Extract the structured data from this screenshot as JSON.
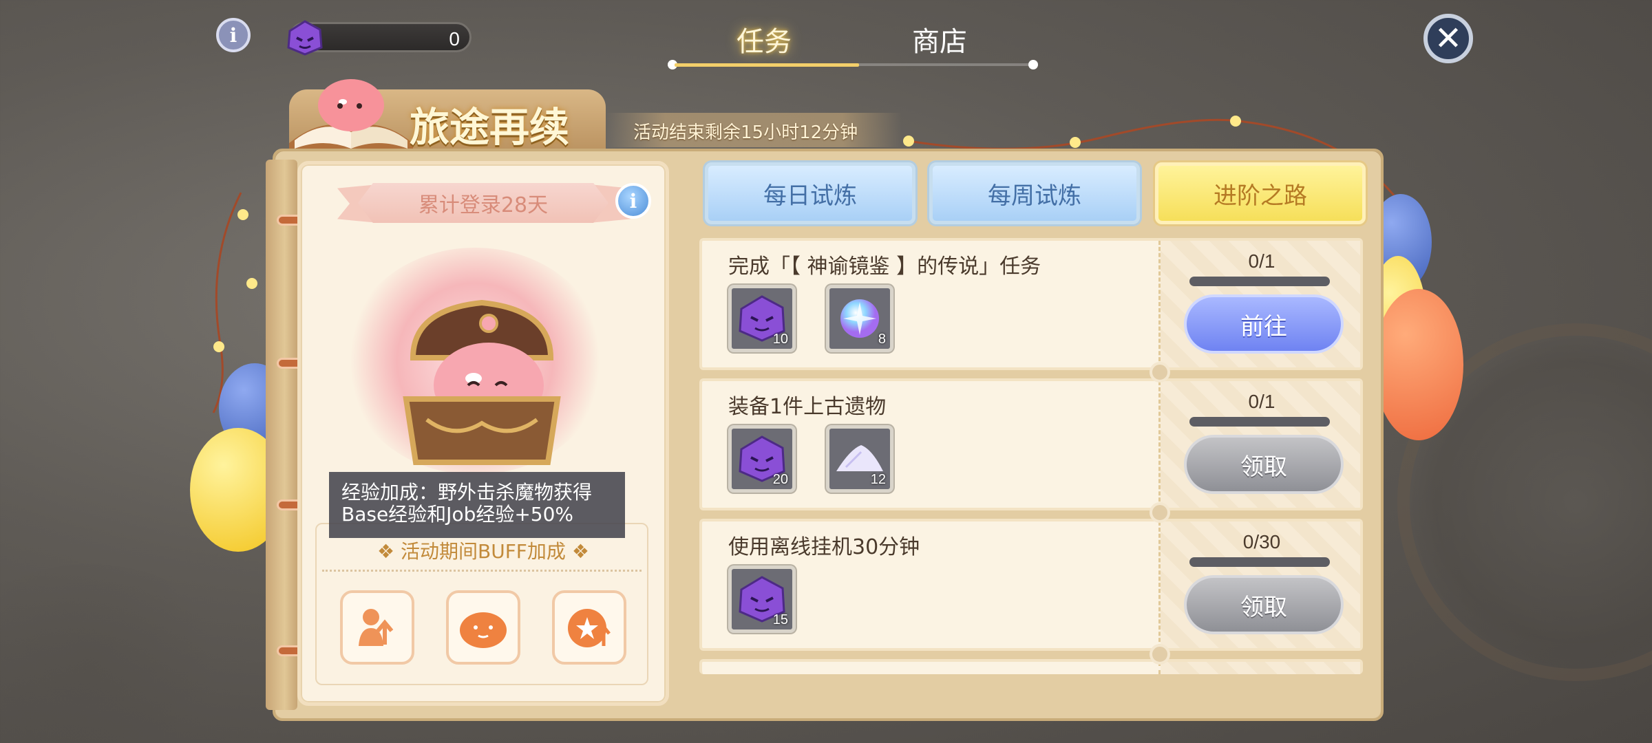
{
  "topbar": {
    "info_label": "i",
    "currency_value": "0",
    "tabs": [
      {
        "label": "任务",
        "active": true
      },
      {
        "label": "商店",
        "active": false
      }
    ],
    "close_label": "✕"
  },
  "event": {
    "title": "旅途再续",
    "time_left": "活动结束剩余15小时12分钟"
  },
  "login_card": {
    "ribbon": "累计登录28天",
    "info_label": "i",
    "tooltip_line1": "经验加成：野外击杀魔物获得",
    "tooltip_line2": "Base经验和Job经验+50%",
    "buff_title": "❖ 活动期间BUFF加成 ❖",
    "buff_icons": [
      "exp-up-icon",
      "poring-icon",
      "job-up-icon"
    ]
  },
  "subtabs": [
    {
      "label": "每日试炼",
      "style": "blue"
    },
    {
      "label": "每周试炼",
      "style": "blue"
    },
    {
      "label": "进阶之路",
      "style": "yellow"
    }
  ],
  "tasks": [
    {
      "title": "完成「【 神谕镜鉴 】的传说」任务",
      "progress": "0/1",
      "rewards": [
        {
          "icon": "purple-poring-gem-icon",
          "count": "10"
        },
        {
          "icon": "crystal-orb-icon",
          "count": "8"
        }
      ],
      "button": "前往",
      "button_state": "go"
    },
    {
      "title": "装备1件上古遗物",
      "progress": "0/1",
      "rewards": [
        {
          "icon": "purple-poring-gem-icon",
          "count": "20"
        },
        {
          "icon": "powder-pile-icon",
          "count": "12"
        }
      ],
      "button": "领取",
      "button_state": "disabled"
    },
    {
      "title": "使用离线挂机30分钟",
      "progress": "0/30",
      "rewards": [
        {
          "icon": "purple-poring-gem-icon",
          "count": "15"
        }
      ],
      "button": "领取",
      "button_state": "disabled"
    }
  ],
  "colors": {
    "accent_gold": "#f3cf6a",
    "go_button": "#6f83f2",
    "disabled_button": "#8f9096",
    "yellow_tab": "#f6df5a",
    "blue_tab": "#a9d0f6"
  }
}
